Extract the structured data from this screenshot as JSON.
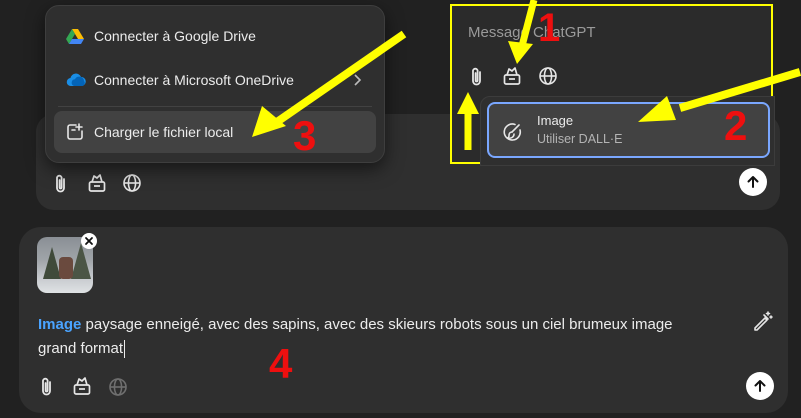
{
  "menu": {
    "items": [
      {
        "label": "Connecter à Google Drive",
        "icon": "google-drive-icon"
      },
      {
        "label": "Connecter à Microsoft OneDrive",
        "icon": "onedrive-icon"
      },
      {
        "label": "Charger le fichier local",
        "icon": "upload-file-icon"
      }
    ]
  },
  "inset": {
    "placeholder": "Message ChatGPT",
    "tool_menu": {
      "title": "Image",
      "subtitle": "Utiliser DALL·E",
      "icon": "image-brush-icon"
    }
  },
  "prompt": {
    "tag": "Image",
    "line1": " paysage enneigé, avec des sapins, avec des skieurs robots sous un ciel brumeux image",
    "line2": "grand format"
  },
  "annotations": [
    "1",
    "2",
    "3",
    "4"
  ],
  "colors": {
    "annotation_arrow": "#ffff00",
    "annotation_number": "#ee0f0f",
    "tag": "#4aa3ff",
    "highlight": "#7aa7ff"
  },
  "icons": [
    "paperclip-icon",
    "tools-icon",
    "globe-icon",
    "send-arrow-icon",
    "edit-wand-icon",
    "close-icon",
    "chevron-right-icon"
  ]
}
